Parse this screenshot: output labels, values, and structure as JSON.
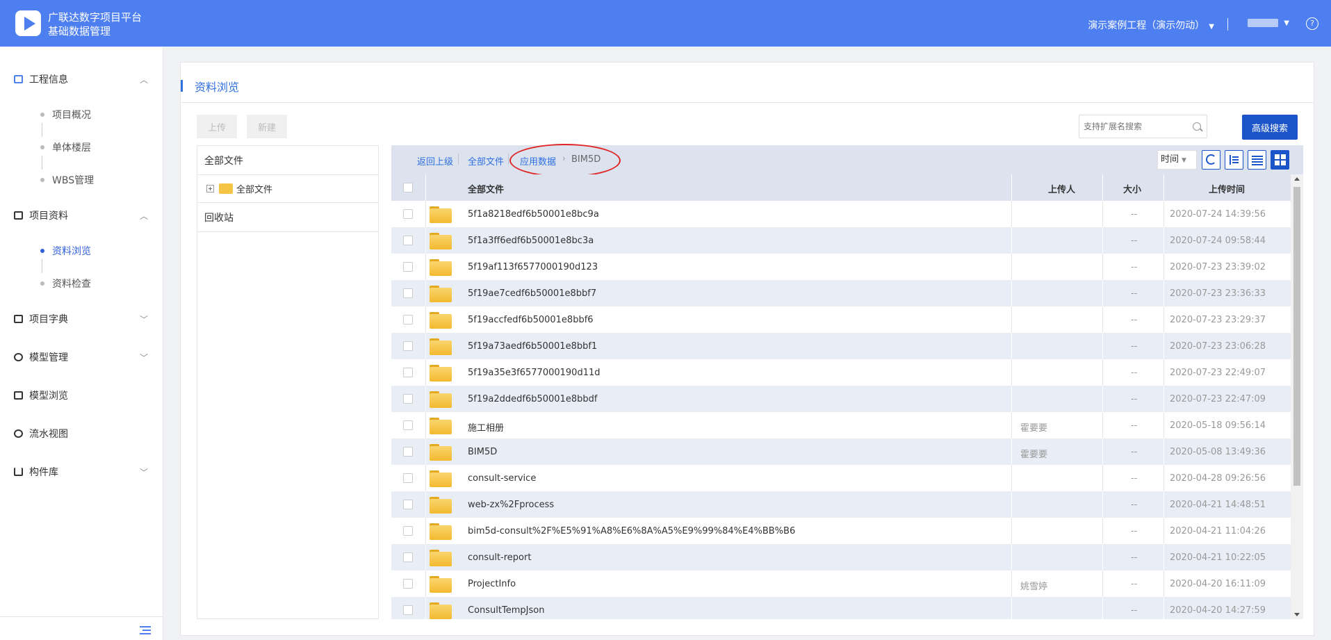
{
  "header": {
    "brand_line1": "广联达数字项目平台",
    "brand_line2": "基础数据管理",
    "project": "演示案例工程（演示勿动）",
    "help": "?"
  },
  "sidebar": {
    "sections": [
      {
        "label": "工程信息",
        "expanded": true
      },
      {
        "label": "项目资料",
        "expanded": true
      },
      {
        "label": "项目字典",
        "expanded": false
      },
      {
        "label": "模型管理",
        "expanded": false
      },
      {
        "label": "模型浏览"
      },
      {
        "label": "流水视图"
      },
      {
        "label": "构件库",
        "expanded": false
      }
    ],
    "sub_items": [
      "项目概况",
      "单体楼层",
      "WBS管理",
      "资料浏览",
      "资料检查"
    ],
    "active_item": "资料浏览"
  },
  "page": {
    "title": "资料浏览",
    "upload_label": "上传",
    "new_label": "新建",
    "search_placeholder": "支持扩展名搜索",
    "advanced_search_label": "高级搜索"
  },
  "tree": {
    "root_label": "全部文件",
    "folder_label": "全部文件",
    "recycle_label": "回收站"
  },
  "breadcrumb": {
    "back": "返回上级",
    "all_files": "全部文件",
    "parent": "应用数据",
    "current": "BIM5D"
  },
  "sort": {
    "label": "时间"
  },
  "table": {
    "headers": {
      "name": "全部文件",
      "uploader": "上传人",
      "size": "大小",
      "time": "上传时间"
    },
    "rows": [
      {
        "name": "5f1a8218edf6b50001e8bc9a",
        "uploader": "",
        "size": "--",
        "time": "2020-07-24 14:39:56"
      },
      {
        "name": "5f1a3ff6edf6b50001e8bc3a",
        "uploader": "",
        "size": "--",
        "time": "2020-07-24 09:58:44"
      },
      {
        "name": "5f19af113f6577000190d123",
        "uploader": "",
        "size": "--",
        "time": "2020-07-23 23:39:02"
      },
      {
        "name": "5f19ae7cedf6b50001e8bbf7",
        "uploader": "",
        "size": "--",
        "time": "2020-07-23 23:36:33"
      },
      {
        "name": "5f19accfedf6b50001e8bbf6",
        "uploader": "",
        "size": "--",
        "time": "2020-07-23 23:29:37"
      },
      {
        "name": "5f19a73aedf6b50001e8bbf1",
        "uploader": "",
        "size": "--",
        "time": "2020-07-23 23:06:28"
      },
      {
        "name": "5f19a35e3f6577000190d11d",
        "uploader": "",
        "size": "--",
        "time": "2020-07-23 22:49:07"
      },
      {
        "name": "5f19a2ddedf6b50001e8bbdf",
        "uploader": "",
        "size": "--",
        "time": "2020-07-23 22:47:09"
      },
      {
        "name": "施工相册",
        "uploader": "霍要要",
        "size": "--",
        "time": "2020-05-18 09:56:14"
      },
      {
        "name": "BIM5D",
        "uploader": "霍要要",
        "size": "--",
        "time": "2020-05-08 13:49:36"
      },
      {
        "name": "consult-service",
        "uploader": "",
        "size": "--",
        "time": "2020-04-28 09:26:56"
      },
      {
        "name": "web-zx%2Fprocess",
        "uploader": "",
        "size": "--",
        "time": "2020-04-21 14:48:51"
      },
      {
        "name": "bim5d-consult%2F%E5%91%A8%E6%8A%A5%E9%99%84%E4%BB%B6",
        "uploader": "",
        "size": "--",
        "time": "2020-04-21 11:04:26"
      },
      {
        "name": "consult-report",
        "uploader": "",
        "size": "--",
        "time": "2020-04-21 10:22:05"
      },
      {
        "name": "ProjectInfo",
        "uploader": "姚雪婷",
        "size": "--",
        "time": "2020-04-20 16:11:09"
      },
      {
        "name": "ConsultTempJson",
        "uploader": "",
        "size": "--",
        "time": "2020-04-20 14:27:59"
      }
    ]
  },
  "colors": {
    "header": "#4d7ff0",
    "accent": "#1b55c9",
    "link": "#2f6fe0",
    "folder": "#f6c445",
    "highlight_oval": "#e02424"
  },
  "icons": [
    "logo-icon",
    "help-icon",
    "search-icon",
    "refresh-icon",
    "tree-view-icon",
    "list-view-icon",
    "grid-view-icon",
    "folder-icon",
    "collapse-sidebar-icon"
  ]
}
